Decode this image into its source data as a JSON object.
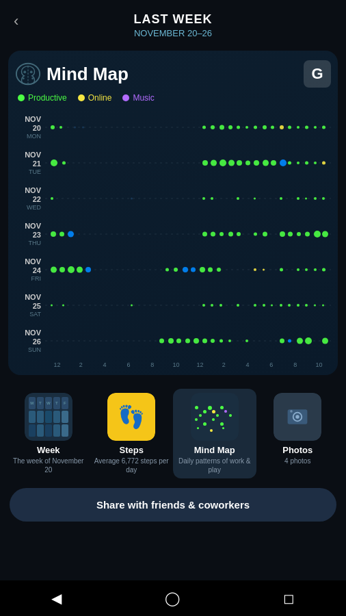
{
  "header": {
    "title": "LAST WEEK",
    "subtitle": "NOVEMBER 20–26",
    "back_icon": "‹"
  },
  "card": {
    "title": "Mind Map",
    "g_label": "G"
  },
  "legend": [
    {
      "label": "Productive",
      "color": "#4cff44"
    },
    {
      "label": "Online",
      "color": "#f5e642"
    },
    {
      "label": "Music",
      "color": "#b36cff"
    }
  ],
  "days": [
    {
      "name": "NOV 20",
      "weekday": "MON"
    },
    {
      "name": "NOV 21",
      "weekday": "TUE"
    },
    {
      "name": "NOV 22",
      "weekday": "WED"
    },
    {
      "name": "NOV 23",
      "weekday": "THU"
    },
    {
      "name": "NOV 24",
      "weekday": "FRI"
    },
    {
      "name": "NOV 25",
      "weekday": "SAT"
    },
    {
      "name": "NOV 26",
      "weekday": "SUN"
    }
  ],
  "time_labels": [
    "12",
    "2",
    "4",
    "6",
    "8",
    "10",
    "12",
    "2",
    "4",
    "6",
    "8",
    "10"
  ],
  "thumbnails": [
    {
      "id": "week",
      "title": "Week",
      "sub": "The week of November 20",
      "active": false
    },
    {
      "id": "steps",
      "title": "Steps",
      "sub": "Average 6,772 steps per day",
      "active": false
    },
    {
      "id": "mindmap",
      "title": "Mind Map",
      "sub": "Daily patterns of work & play",
      "active": true
    },
    {
      "id": "photos",
      "title": "Photos",
      "sub": "4 photos",
      "active": false
    }
  ],
  "share": {
    "label": "Share with friends & coworkers"
  },
  "nav": {
    "back": "◀",
    "home": "◯",
    "square": "◻"
  }
}
